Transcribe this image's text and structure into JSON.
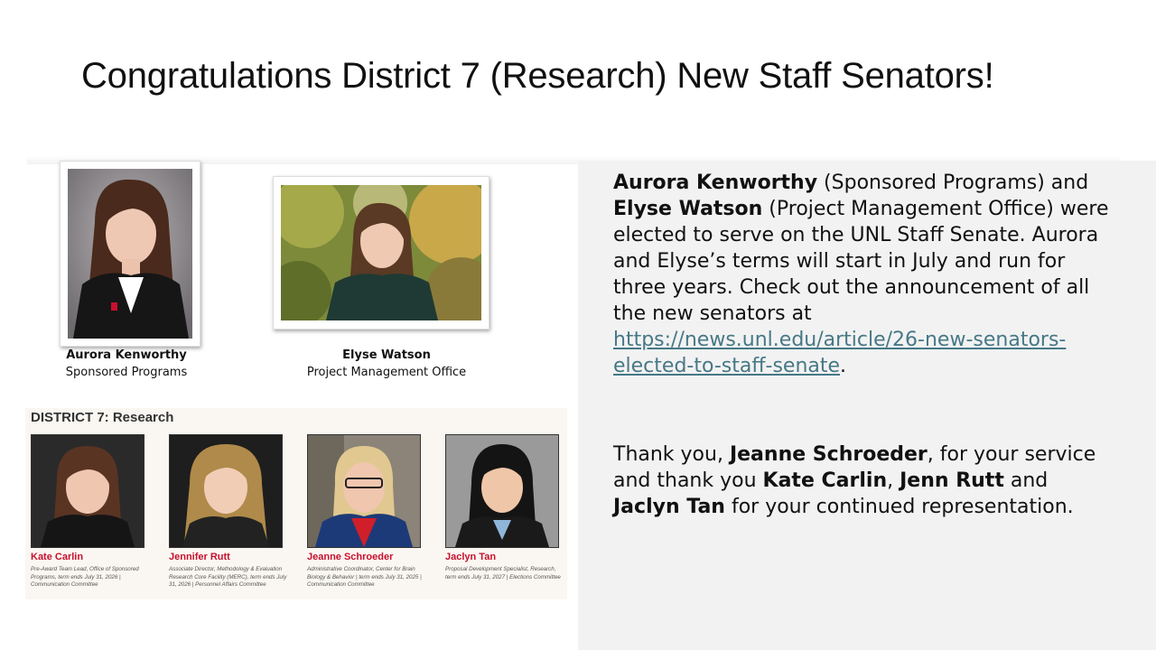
{
  "slide": {
    "title": "Congratulations District 7 (Research) New Staff Senators!"
  },
  "new_senators": [
    {
      "name": "Aurora Kenworthy",
      "dept": "Sponsored Programs"
    },
    {
      "name": "Elyse Watson",
      "dept": "Project Management Office"
    }
  ],
  "announcement": {
    "p1_name1": "Aurora Kenworthy",
    "p1_dept1": " (Sponsored Programs) and ",
    "p1_name2": "Elyse Watson",
    "p1_text": " (Project Management Office) were elected to serve on the UNL Staff Senate. Aurora and Elyse’s terms will start in July and run for three years. Check out the announcement of all the new senators at ",
    "p1_link": "https://news.unl.edu/article/26-new-senators-elected-to-staff-senate",
    "p1_end": ".",
    "p2_start": "Thank you, ",
    "p2_name1": "Jeanne Schroeder",
    "p2_mid1": ", for your service and thank you ",
    "p2_name2": "Kate Carlin",
    "p2_mid2": ", ",
    "p2_name3": "Jenn Rutt",
    "p2_mid3": " and ",
    "p2_name4": "Jaclyn Tan",
    "p2_end": " for your continued representation."
  },
  "district": {
    "heading": "DISTRICT 7: Research",
    "members": [
      {
        "name": "Kate Carlin",
        "desc": "Pre-Award Team Lead, Office of Sponsored Programs, term ends July 31, 2026 | Communication Committee"
      },
      {
        "name": "Jennifer Rutt",
        "desc": "Associate Director, Methodology & Evaluation Research Core Facility (MERC), term ends July 31, 2026 | Personnel Affairs Committee"
      },
      {
        "name": "Jeanne Schroeder",
        "desc": "Administrative Coordinator, Center for Brain Biology & Behavior | term ends July 31, 2025 | Communication Committee"
      },
      {
        "name": "Jaclyn Tan",
        "desc": "Proposal Development Specialist, Research, term ends July 31, 2027 | Elections Committee"
      }
    ]
  },
  "colors": {
    "link": "#467886",
    "accent_red": "#c8102e",
    "panel_bg": "#f2f2f2"
  }
}
